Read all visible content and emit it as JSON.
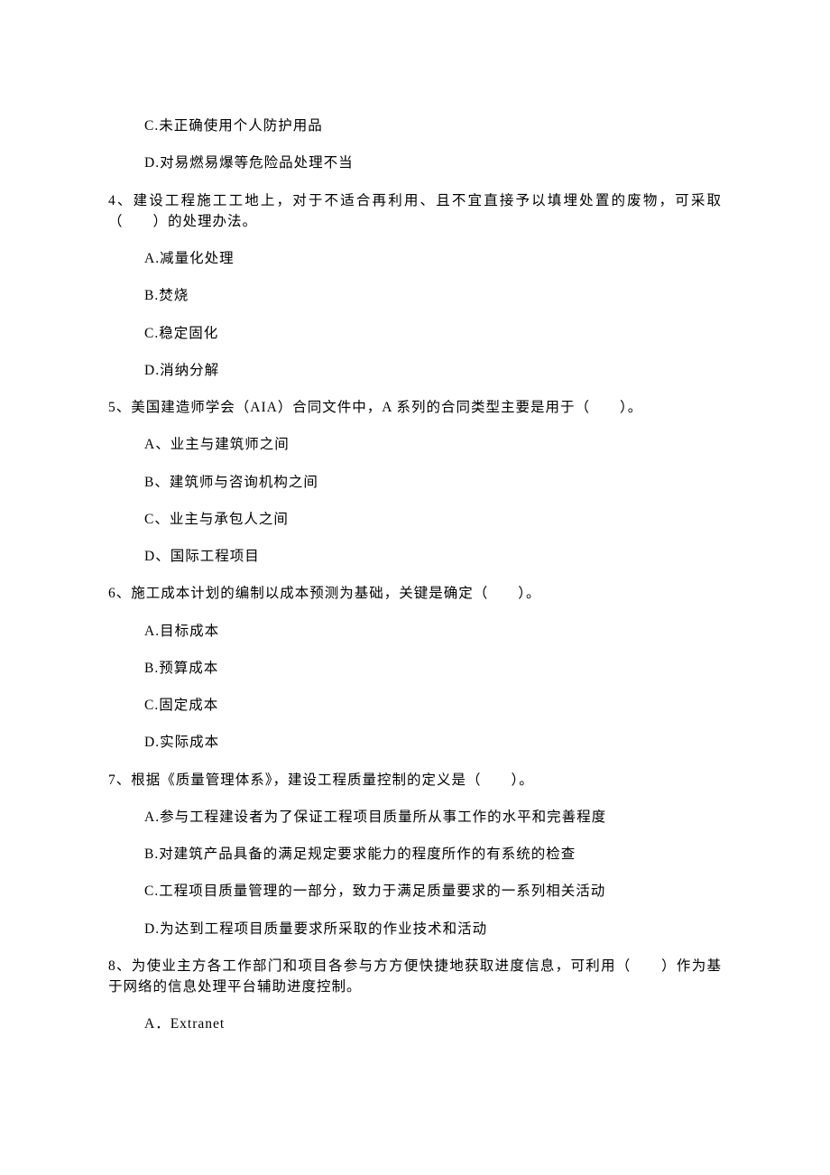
{
  "q_prev_options": {
    "c": "C.未正确使用个人防护用品",
    "d": "D.对易燃易爆等危险品处理不当"
  },
  "q4": {
    "stem": "4、建设工程施工工地上，对于不适合再利用、且不宜直接予以填埋处置的废物，可采取（　　）的处理办法。",
    "a": "A.减量化处理",
    "b": "B.焚烧",
    "c": "C.稳定固化",
    "d": "D.消纳分解"
  },
  "q5": {
    "stem": "5、美国建造师学会（AIA）合同文件中，A 系列的合同类型主要是用于（　　）。",
    "a": "A、业主与建筑师之间",
    "b": "B、建筑师与咨询机构之间",
    "c": "C、业主与承包人之间",
    "d": "D、国际工程项目"
  },
  "q6": {
    "stem": "6、施工成本计划的编制以成本预测为基础，关键是确定（　　）。",
    "a": "A.目标成本",
    "b": "B.预算成本",
    "c": "C.固定成本",
    "d": "D.实际成本"
  },
  "q7": {
    "stem": "7、根据《质量管理体系》，建设工程质量控制的定义是（　　）。",
    "a": "A.参与工程建设者为了保证工程项目质量所从事工作的水平和完善程度",
    "b": "B.对建筑产品具备的满足规定要求能力的程度所作的有系统的检查",
    "c": "C.工程项目质量管理的一部分，致力于满足质量要求的一系列相关活动",
    "d": "D.为达到工程项目质量要求所采取的作业技术和活动"
  },
  "q8": {
    "stem": "8、为使业主方各工作部门和项目各参与方方便快捷地获取进度信息，可利用（　　）作为基于网络的信息处理平台辅助进度控制。",
    "a": "A．Extranet"
  }
}
